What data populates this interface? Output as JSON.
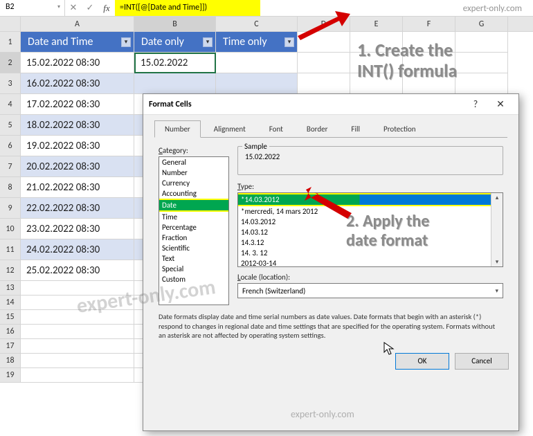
{
  "brand": "expert-only.com",
  "watermark": "expert-only.com",
  "nameBox": "B2",
  "formula": "=INT([@[Date and Time]])",
  "colHeaders": [
    "A",
    "B",
    "C",
    "D",
    "E",
    "F",
    "G"
  ],
  "tableHeaders": {
    "a": "Date and Time",
    "b": "Date only",
    "c": "Time only"
  },
  "rows": [
    {
      "n": 1
    },
    {
      "n": 2,
      "a": "15.02.2022 08:30",
      "b": "15.02.2022"
    },
    {
      "n": 3,
      "a": "16.02.2022 08:30"
    },
    {
      "n": 4,
      "a": "17.02.2022 08:30"
    },
    {
      "n": 5,
      "a": "18.02.2022 08:30"
    },
    {
      "n": 6,
      "a": "19.02.2022 08:30"
    },
    {
      "n": 7,
      "a": "20.02.2022 08:30"
    },
    {
      "n": 8,
      "a": "21.02.2022 08:30"
    },
    {
      "n": 9,
      "a": "22.02.2022 08:30"
    },
    {
      "n": 10,
      "a": "23.02.2022 08:30"
    },
    {
      "n": 11,
      "a": "24.02.2022 08:30"
    },
    {
      "n": 12,
      "a": "25.02.2022 08:30"
    },
    {
      "n": 13
    },
    {
      "n": 14
    },
    {
      "n": 15
    },
    {
      "n": 16
    },
    {
      "n": 17
    },
    {
      "n": 18
    },
    {
      "n": 19
    }
  ],
  "annot": {
    "a1": "1. Create the\nINT() formula",
    "a2": "2. Apply the\ndate format"
  },
  "dialog": {
    "title": "Format Cells",
    "tabs": [
      "Number",
      "Alignment",
      "Font",
      "Border",
      "Fill",
      "Protection"
    ],
    "categoryLabel": "Category:",
    "categories": [
      "General",
      "Number",
      "Currency",
      "Accounting",
      "Date",
      "Time",
      "Percentage",
      "Fraction",
      "Scientific",
      "Text",
      "Special",
      "Custom"
    ],
    "selectedCategory": "Date",
    "sampleLabel": "Sample",
    "sampleValue": "15.02.2022",
    "typeLabel": "Type:",
    "types": [
      "*14.03.2012",
      "*mercredi, 14 mars 2012",
      "14.03.2012",
      "14.03.12",
      "14.3.12",
      "14. 3. 12",
      "2012-03-14"
    ],
    "selectedType": "*14.03.2012",
    "localeLabel": "Locale (location):",
    "locale": "French (Switzerland)",
    "info": "Date formats display date and time serial numbers as date values.  Date formats that begin with an asterisk (*) respond to changes in regional date and time settings that are specified for the operating system. Formats without an asterisk are not affected by operating system settings.",
    "ok": "OK",
    "cancel": "Cancel"
  }
}
